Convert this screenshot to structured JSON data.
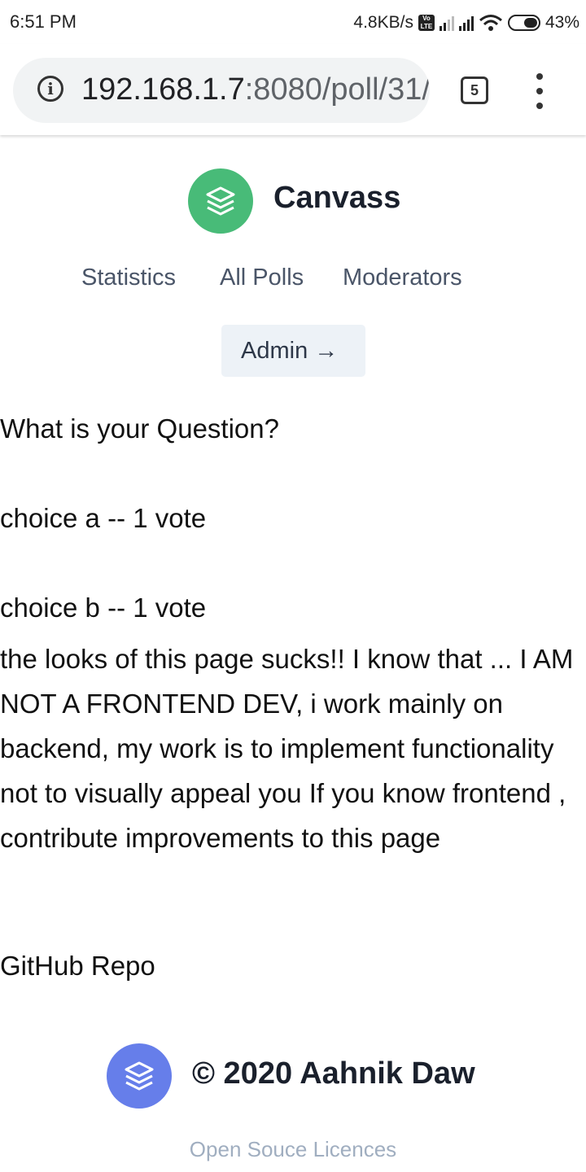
{
  "status_bar": {
    "time": "6:51 PM",
    "network_speed": "4.8KB/s",
    "volte": "Vo LTE",
    "battery": "43%",
    "icons": [
      "volte-icon",
      "signal-icon",
      "signal-icon",
      "wifi-icon",
      "battery-icon"
    ]
  },
  "browser": {
    "url_host": "192.168.1.7",
    "url_rest": ":8080/poll/31/",
    "tab_count": "5"
  },
  "header": {
    "brand": "Canvass",
    "nav": [
      "Statistics",
      "All Polls",
      "Moderators"
    ],
    "admin_label": "Admin",
    "admin_arrow": "→"
  },
  "poll": {
    "question": "What is your Question?",
    "choices": [
      "choice a -- 1 vote",
      "choice b -- 1 vote"
    ],
    "note": "the looks of this page sucks!! I know that ... I AM NOT A FRONTEND DEV, i work mainly on backend, my work is to implement functionality not to visually appeal you If you know frontend , contribute improvements to this page",
    "github_link": "GitHub Repo"
  },
  "footer": {
    "copyright": "© 2020 Aahnik Daw",
    "licences_link": "Open Souce Licences"
  },
  "colors": {
    "brand_green": "#48bb78",
    "footer_indigo": "#667eea",
    "nav_text": "#4a5568",
    "button_bg": "#edf2f7",
    "muted_link": "#a0aec0"
  }
}
